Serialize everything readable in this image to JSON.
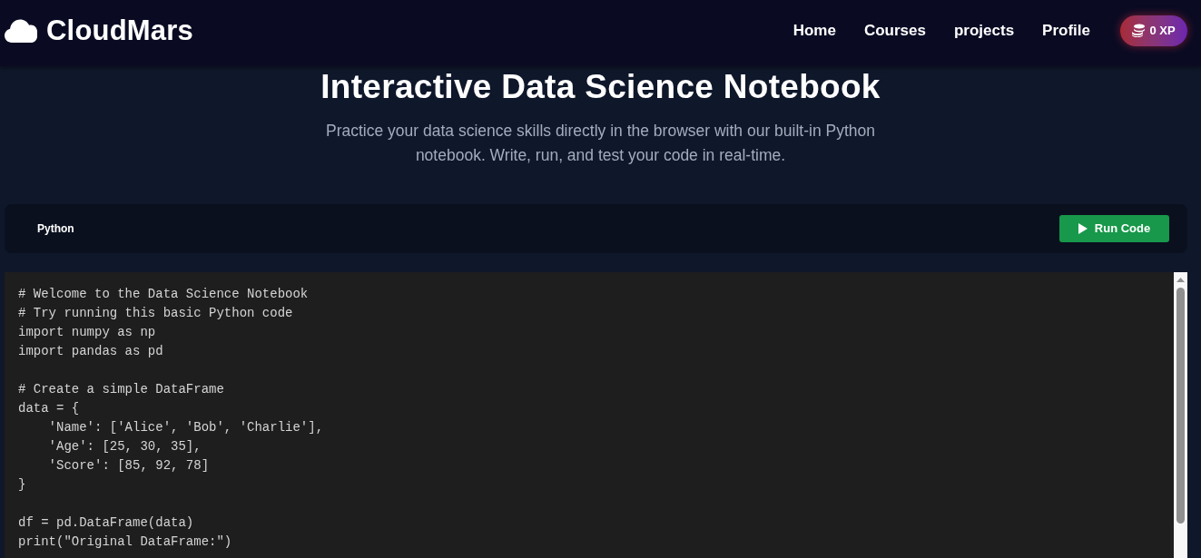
{
  "header": {
    "logo": "CloudMars",
    "nav": [
      "Home",
      "Courses",
      "projects",
      "Profile"
    ],
    "xp_badge": "0 XP"
  },
  "hero": {
    "title": "Interactive Data Science Notebook",
    "subtitle": "Practice your data science skills directly in the browser with our built-in Python notebook. Write, run, and test your code in real-time."
  },
  "toolbar": {
    "language": "Python",
    "run_button": "Run Code"
  },
  "editor": {
    "code_blocks": [
      [
        "# Welcome to the Data Science Notebook",
        "# Try running this basic Python code",
        "import numpy as np",
        "import pandas as pd"
      ],
      [
        "# Create a simple DataFrame",
        "data = {",
        "    'Name': ['Alice', 'Bob', 'Charlie'],",
        "    'Age': [25, 30, 35],",
        "    'Score': [85, 92, 78]",
        "}"
      ],
      [
        "df = pd.DataFrame(data)",
        "print(\"Original DataFrame:\")"
      ]
    ]
  }
}
